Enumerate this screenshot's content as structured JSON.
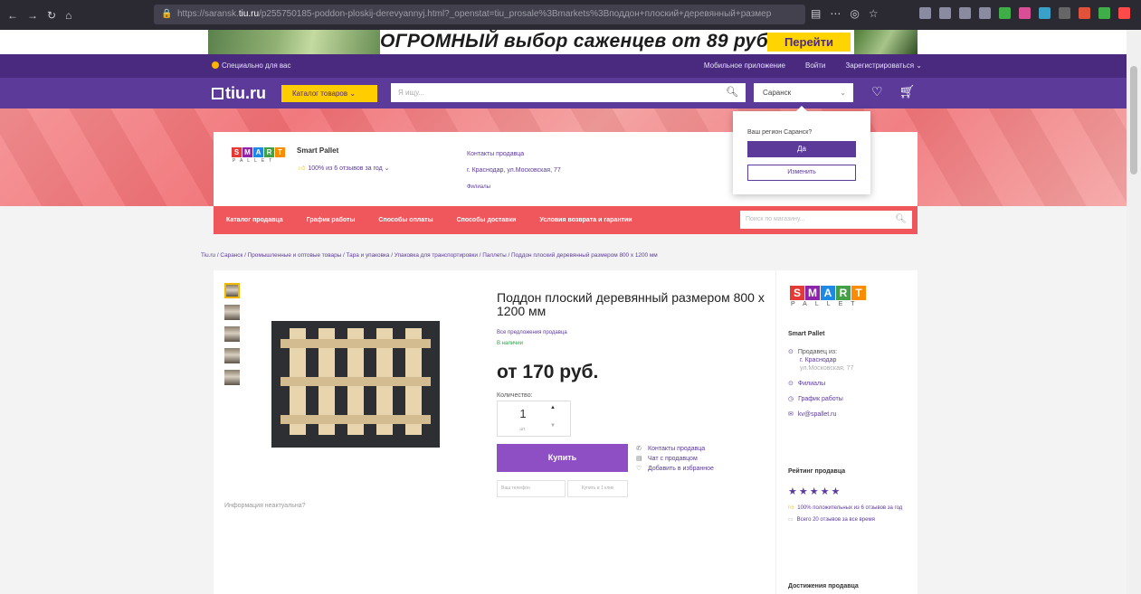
{
  "browser": {
    "url_pre": "https://saransk.",
    "url_host": "tiu.ru",
    "url_post": "/p255750185-poddon-ploskij-derevyannyj.html?_openstat=tiu_prosale%3Bmarkets%3Bподдон+плоский+деревянный+размер"
  },
  "banner": {
    "text": "ОГРОМНЫЙ выбор саженцев от 89 руб.",
    "button": "Перейти"
  },
  "topbar": {
    "special": "Специально для вас",
    "mobile": "Мобильное приложение",
    "login": "Войти",
    "register": "Зарегистрироваться"
  },
  "header": {
    "logo": "tiu.ru",
    "catalog": "Каталог товаров",
    "search_placeholder": "Я ищу...",
    "region": "Саранск"
  },
  "seller_card": {
    "logo_letters": [
      "S",
      "M",
      "A",
      "R",
      "T"
    ],
    "logo_sub": "PALLET",
    "name": "Smart Pallet",
    "reviews": "100% из 6 отзывов за год",
    "contacts": "Контакты продавца",
    "address": "г. Краснодар, ул.Московская, 77",
    "branches": "Филиалы"
  },
  "region_popup": {
    "question": "Ваш регион Саранск?",
    "yes": "Да",
    "change": "Изменить"
  },
  "menu": {
    "items": [
      "Каталог продавца",
      "График работы",
      "Способы оплаты",
      "Способы доставки",
      "Условия возврата и гарантии"
    ],
    "search_placeholder": "Поиск по магазину..."
  },
  "breadcrumb": "Tiu.ru / Саранск / Промышленные и оптовые товары / Тара и упаковка / Упаковка для транспортировки / Паллеты / Поддон плоский деревянный размером 800 х 1200 мм",
  "product": {
    "title": "Поддон плоский деревянный размером 800 х 1200 мм",
    "all_offers": "Все предложения продавца",
    "stock": "В наличии",
    "price": "от 170 руб.",
    "qty_label": "Количество:",
    "qty": "1",
    "unit": "шт.",
    "buy": "Купить",
    "phone_placeholder": "Ваш телефон",
    "one_click": "Купить в 1 клик",
    "links": [
      "Контакты продавца",
      "Чат с продавцом",
      "Добавить в избранное"
    ],
    "info": "Информация неактуальна?"
  },
  "sidebar": {
    "name": "Smart Pallet",
    "seller_from": "Продавец из:",
    "city": "г. Краснодар",
    "street": "ул.Московская, 77",
    "branches": "Филиалы",
    "schedule": "График работы",
    "email": "kv@spallet.ru",
    "rating_title": "Рейтинг продавца",
    "stars": "★★★★★",
    "positive": "100% положительных из 6 отзывов за год",
    "total": "Всего 20 отзывов за все время",
    "achievements": "Достижения продавца"
  },
  "colors": {
    "brand": "#5b3a9a",
    "accent": "#ffcd00",
    "menu": "#f0575d",
    "logo": [
      "#e53935",
      "#8e24aa",
      "#1e88e5",
      "#43a047",
      "#fb8c00"
    ]
  }
}
